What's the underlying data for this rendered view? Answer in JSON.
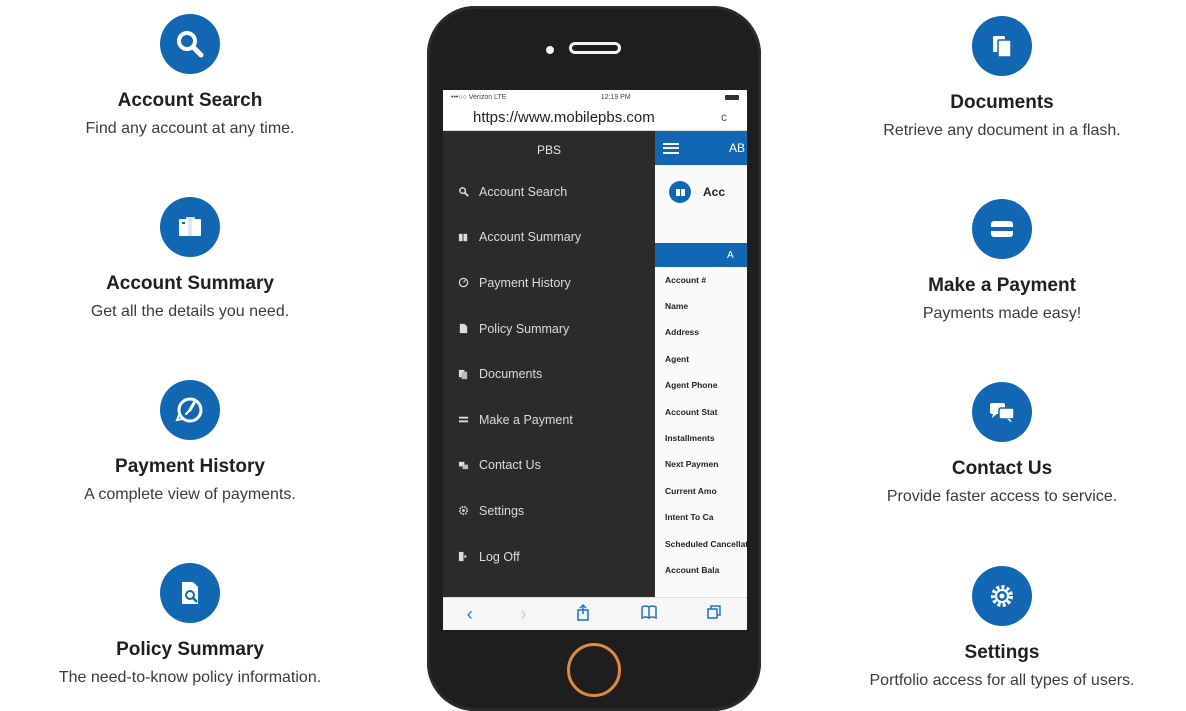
{
  "features_left": [
    {
      "title": "Account Search",
      "desc": "Find any account at any time.",
      "icon": "search-icon"
    },
    {
      "title": "Account Summary",
      "desc": "Get all the details you need.",
      "icon": "folders-icon"
    },
    {
      "title": "Payment History",
      "desc": "A complete view of payments.",
      "icon": "clock-history-icon"
    },
    {
      "title": "Policy Summary",
      "desc": "The need-to-know policy information.",
      "icon": "policy-search-icon"
    }
  ],
  "features_right": [
    {
      "title": "Documents",
      "desc": "Retrieve any document in a flash.",
      "icon": "documents-icon"
    },
    {
      "title": "Make a Payment",
      "desc": "Payments made easy!",
      "icon": "card-icon"
    },
    {
      "title": "Contact Us",
      "desc": "Provide faster access to service.",
      "icon": "chat-icon"
    },
    {
      "title": "Settings",
      "desc": "Portfolio access for all types of users.",
      "icon": "gear-icon"
    }
  ],
  "phone": {
    "status": {
      "carrier": "•••○○ Verizon LTE",
      "time": "12:19 PM"
    },
    "url": "https://www.mobilepbs.com",
    "reload": "c",
    "menu": {
      "title": "PBS",
      "items": [
        {
          "label": "Account Search",
          "icon": "search-icon"
        },
        {
          "label": "Account Summary",
          "icon": "folders-icon"
        },
        {
          "label": "Payment History",
          "icon": "clock-icon"
        },
        {
          "label": "Policy Summary",
          "icon": "policy-icon"
        },
        {
          "label": "Documents",
          "icon": "documents-icon"
        },
        {
          "label": "Make a Payment",
          "icon": "card-icon"
        },
        {
          "label": "Contact Us",
          "icon": "chat-icon"
        },
        {
          "label": "Settings",
          "icon": "gear-icon"
        },
        {
          "label": "Log Off",
          "icon": "logoff-icon"
        }
      ]
    },
    "right_pane": {
      "topbar_text": "AB",
      "account_heading": "Acc",
      "strip_text": "A",
      "fields": [
        "Account #",
        "Name",
        "Address",
        "Agent",
        "Agent Phone",
        "Account Stat",
        "Installments",
        "Next Paymen",
        "Current Amo",
        "Intent To Ca",
        "Scheduled Cancellation",
        "Account Bala"
      ]
    },
    "toolbar": [
      "back-icon",
      "forward-icon",
      "share-icon",
      "bookmarks-icon",
      "tabs-icon"
    ]
  },
  "colors": {
    "accent": "#1167b1",
    "menu_bg": "#2b2b2b",
    "home_ring": "#e28a3a"
  }
}
